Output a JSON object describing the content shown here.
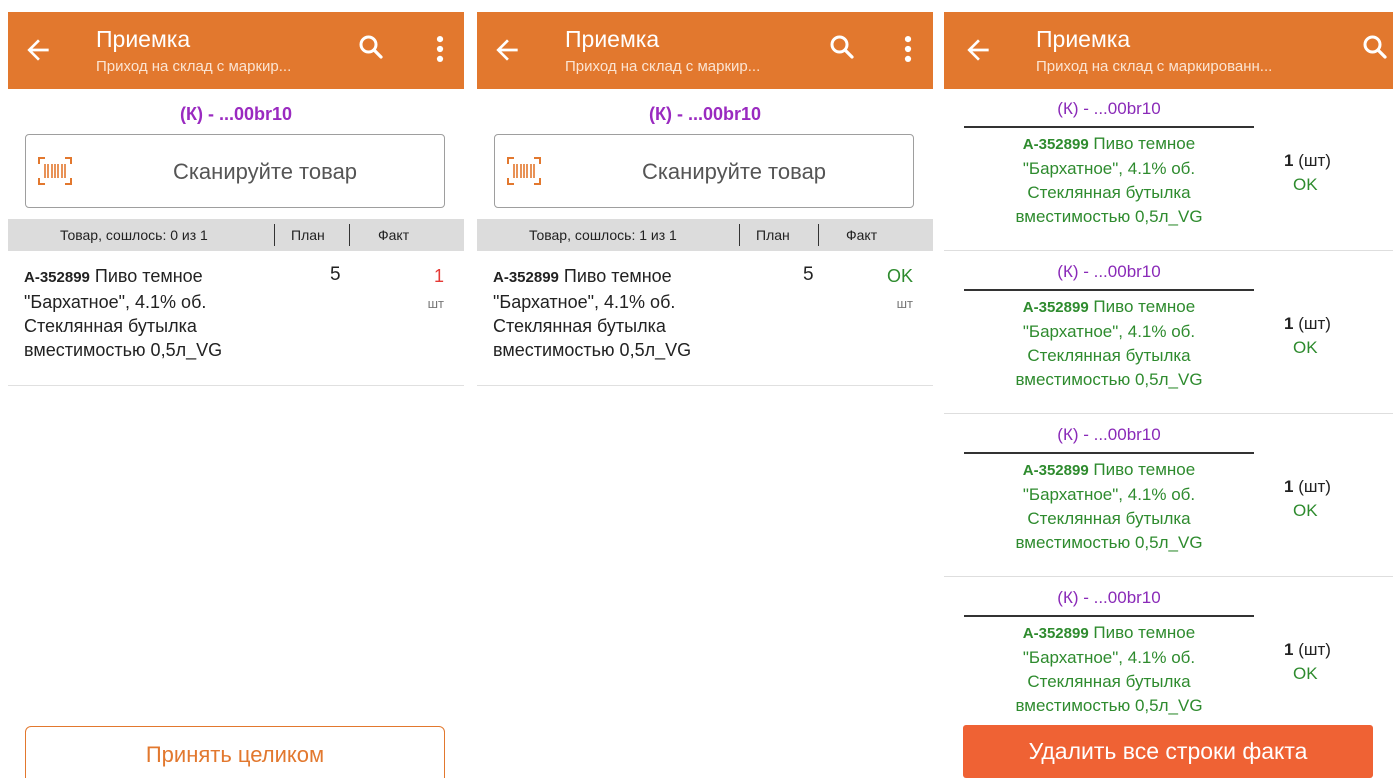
{
  "appbar": {
    "title": "Приемка",
    "subtitle_short": "Приход на склад с маркир...",
    "subtitle_long": "Приход на склад с маркированн...",
    "color": "#e2782e"
  },
  "doc_code": "(К) - ...00br10",
  "scan": {
    "placeholder": "Сканируйте товар"
  },
  "table": {
    "plan_header": "План",
    "fact_header": "Факт",
    "goods_header_s1": "Товар, сошлось: 0 из 1",
    "goods_header_s2": "Товар, сошлось: 1 из 1"
  },
  "product": {
    "code": "А-352899",
    "name": "Пиво темное \"Бархатное\", 4.1% об. Стеклянная бутылка вместимостью 0,5л_VG",
    "name_lines": [
      "Пиво темное",
      "\"Бархатное\", 4.1% об.",
      "Стеклянная бутылка",
      "вместимостью 0,5л_VG"
    ],
    "plan": "5",
    "unit": "шт"
  },
  "screen1": {
    "fact": "1",
    "fact_color": "#e53935",
    "accept_label": "Принять целиком"
  },
  "screen2": {
    "fact": "OK",
    "fact_color": "#2e8b2e"
  },
  "screen3": {
    "items": [
      {
        "code": "(К) - ...00br10",
        "qty": "1",
        "unit": "(шт)",
        "status": "OK"
      },
      {
        "code": "(К) - ...00br10",
        "qty": "1",
        "unit": "(шт)",
        "status": "OK"
      },
      {
        "code": "(К) - ...00br10",
        "qty": "1",
        "unit": "(шт)",
        "status": "OK"
      },
      {
        "code": "(К) - ...00br10",
        "qty": "1",
        "unit": "(шт)",
        "status": "OK"
      }
    ],
    "delete_label": "Удалить все строки факта",
    "delete_color": "#ef6234"
  },
  "icons": {
    "back": "arrow-left-icon",
    "search": "search-icon",
    "menu": "more-vert-icon",
    "barcode": "barcode-scan-icon"
  }
}
